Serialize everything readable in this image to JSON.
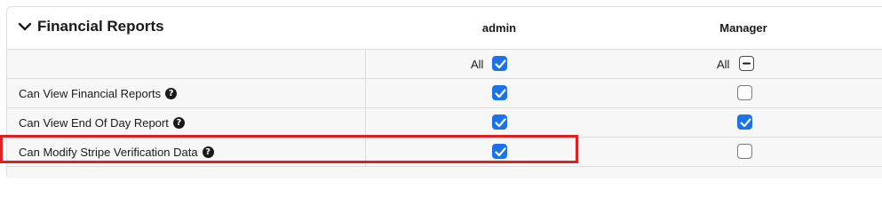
{
  "section": {
    "title": "Financial Reports",
    "chevron_icon": "chevron-down-icon"
  },
  "columns": [
    {
      "name": "admin"
    },
    {
      "name": "Manager"
    }
  ],
  "all_row": {
    "label": "All",
    "admin_state": "checked",
    "manager_state": "indeterminate"
  },
  "permissions": [
    {
      "label": "Can View Financial Reports",
      "admin": true,
      "manager": false
    },
    {
      "label": "Can View End Of Day Report",
      "admin": true,
      "manager": true
    },
    {
      "label": "Can Modify Stripe Verification Data",
      "admin": true,
      "manager": false
    }
  ],
  "help_icon": "help-circle-icon",
  "highlight_color": "#e02020",
  "accent_color": "#1a73e8"
}
